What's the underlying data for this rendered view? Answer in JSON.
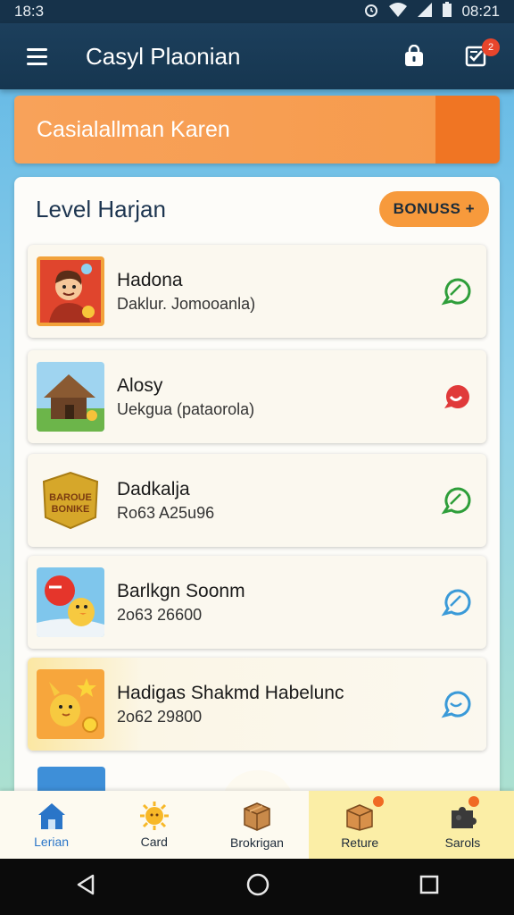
{
  "status_bar": {
    "time_left": "18:3",
    "time_right": "08:21",
    "icons": [
      "alarm-icon",
      "wifi-icon",
      "signal-icon",
      "battery-icon"
    ]
  },
  "app_bar": {
    "title": "Casyl Plaonian",
    "notification_count": "2",
    "icons": [
      "menu-icon",
      "lock-bag-icon",
      "checklist-icon"
    ]
  },
  "promo": {
    "text": "Casialallman Karen",
    "colors": {
      "bg": "#f69a4b",
      "accent": "#f07523"
    }
  },
  "section": {
    "title": "Level Harjan",
    "bonus_label": "BONUSS +"
  },
  "items": [
    {
      "title": "Hadona",
      "subtitle": "Daklur. Jomooanla)",
      "thumb": "character-avatar-icon",
      "action": "leaf-chat-icon",
      "action_color": "#2e9e3a"
    },
    {
      "title": "Alosy",
      "subtitle": "Uekgua (pataorola)",
      "thumb": "hut-icon",
      "action": "red-chat-icon",
      "action_color": "#e03a3a"
    },
    {
      "title": "Dadkalja",
      "subtitle": "Ro63 A25u96",
      "thumb": "bonus-badge-icon",
      "thumb_text": "BAROUE BONIKE",
      "action": "leaf-chat-icon",
      "action_color": "#2e9e3a"
    },
    {
      "title": "Barlkgn Soonm",
      "subtitle": "2o63 26600",
      "thumb": "duck-balloon-icon",
      "action": "blue-chat-icon",
      "action_color": "#3a9ad8"
    },
    {
      "title": "Hadigas Shakmd Habelunc",
      "subtitle": "2o62 29800",
      "thumb": "duck-star-icon",
      "action": "blue-chat-icon",
      "action_color": "#3a9ad8",
      "highlight": true
    }
  ],
  "bottom_nav": [
    {
      "label": "Lerian",
      "icon": "home-icon",
      "active": true
    },
    {
      "label": "Card",
      "icon": "sun-icon"
    },
    {
      "label": "Brokrigan",
      "icon": "crate-icon"
    },
    {
      "label": "Reture",
      "icon": "box-icon",
      "badge": true
    },
    {
      "label": "Sarols",
      "icon": "puzzle-icon",
      "badge": true
    }
  ],
  "system_nav": [
    "back-icon",
    "home-circle-icon",
    "recents-icon"
  ]
}
